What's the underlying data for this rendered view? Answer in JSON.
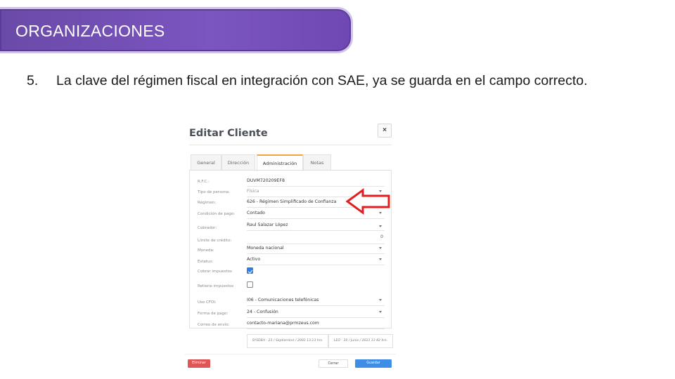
{
  "slide": {
    "banner_title": "ORGANIZACIONES",
    "point_number": "5.",
    "point_text": "La clave del régimen fiscal en integración con SAE, ya se guarda en el campo correcto."
  },
  "modal": {
    "title": "Editar Cliente",
    "close_label": "×",
    "tabs": [
      {
        "label": "General",
        "active": false
      },
      {
        "label": "Dirección",
        "active": false
      },
      {
        "label": "Administración",
        "active": true
      },
      {
        "label": "Notas",
        "active": false
      }
    ],
    "fields": {
      "rfc": {
        "label": "R.F.C.:",
        "value": "DUVM720209EF8"
      },
      "tipo_persona": {
        "label": "Tipo de persona:",
        "value": "Física"
      },
      "regimen": {
        "label": "Régimen:",
        "value": "626 - Régimen Simplificado de Confianza"
      },
      "condicion_pago": {
        "label": "Condición de pago:",
        "value": "Contado"
      },
      "cobrador": {
        "label": "Cobrador:",
        "value": "Raul Salazar López"
      },
      "limite_credito": {
        "label": "Límite de crédito:",
        "value": "0"
      },
      "moneda": {
        "label": "Moneda:",
        "value": "Moneda nacional"
      },
      "estatus": {
        "label": "Estatus:",
        "value": "Activo"
      },
      "cobrar_impuestos": {
        "label": "Cobrar impuestos",
        "checked": true
      },
      "retiene_impuestos": {
        "label": "Retiene impuestos",
        "checked": false
      },
      "uso_cfdi": {
        "label": "Uso CFDI:",
        "value": "I06 - Comunicaciones telefónicas"
      },
      "forma_pago": {
        "label": "Forma de pago:",
        "value": "24 - Confusión"
      },
      "correo_envio": {
        "label": "Correo de envío:",
        "value": "contacto-mariana@prmzeus.com"
      }
    },
    "audit": {
      "created": "SYSDBA - 23 / Septiembre / 2003 13:13 hrs.",
      "modified": "LEO - 30 / Junio / 2023 11:42 hrs."
    },
    "buttons": {
      "delete": "Eliminar",
      "close": "Cerrar",
      "save": "Guardar"
    }
  },
  "colors": {
    "banner": "#6a4aa8",
    "annotation_arrow": "#e02020",
    "active_tab_accent": "#f0a53c",
    "save_button": "#3e8ee6",
    "delete_button": "#e05555"
  }
}
